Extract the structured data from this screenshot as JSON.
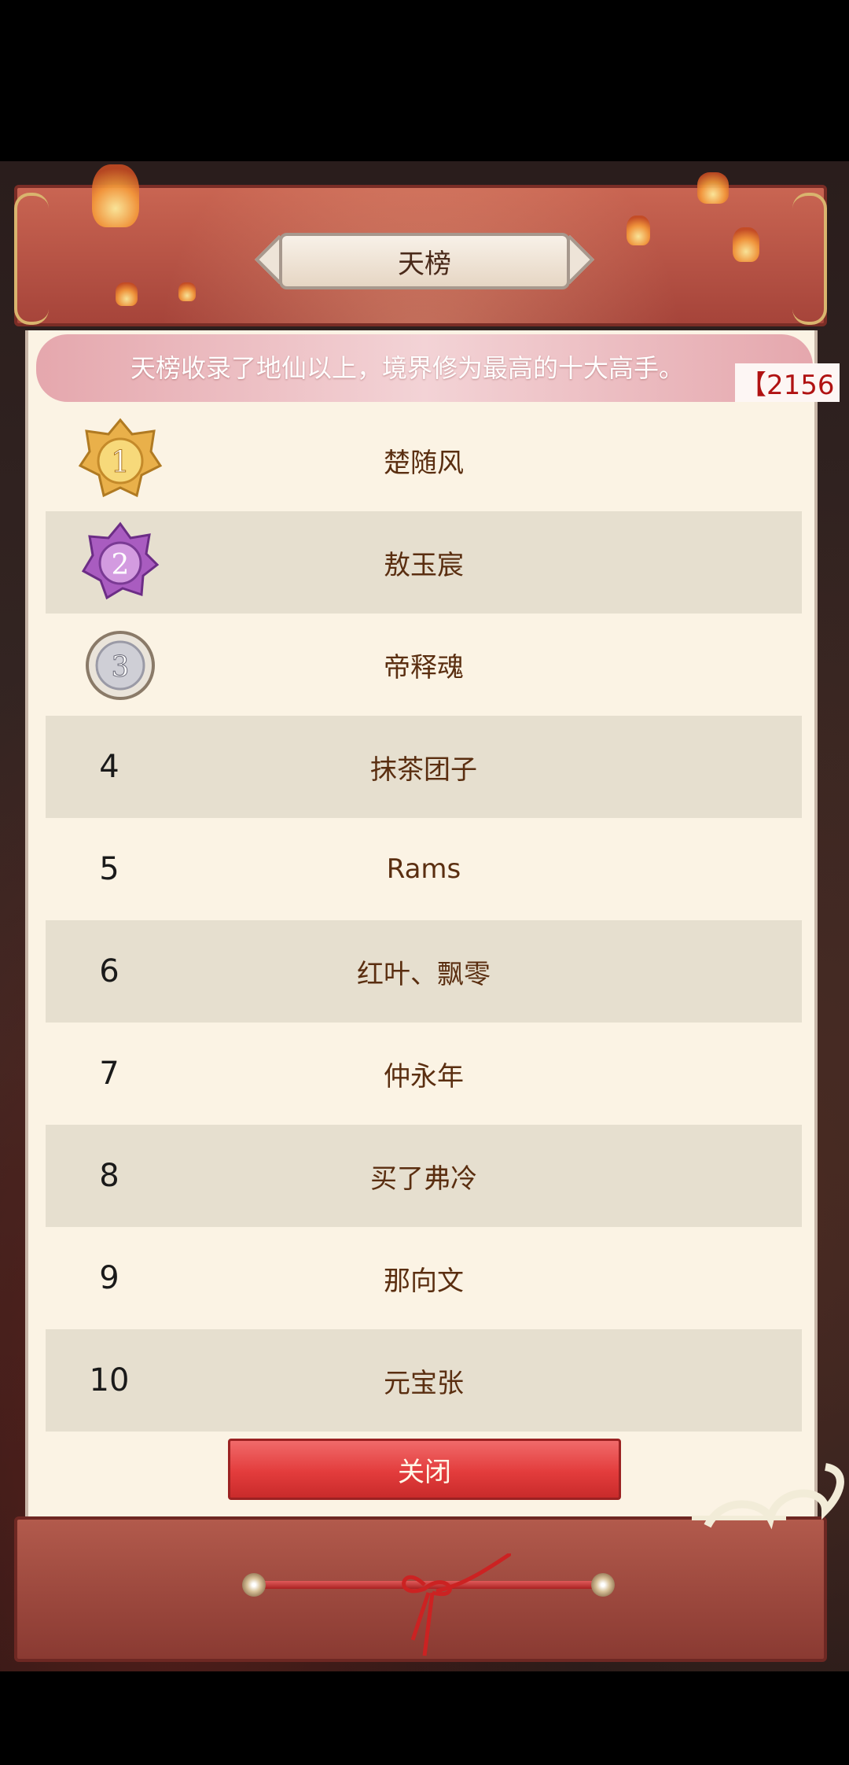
{
  "title": "天榜",
  "notice": {
    "text": "天榜收录了地仙以上，境界修为最高的十大高手。",
    "trailing": "【2156"
  },
  "rankings": [
    {
      "rank": "1",
      "name": "楚随风",
      "medal": "gold"
    },
    {
      "rank": "2",
      "name": "敖玉宸",
      "medal": "purple"
    },
    {
      "rank": "3",
      "name": "帝释魂",
      "medal": "silver"
    },
    {
      "rank": "4",
      "name": "抹茶团子"
    },
    {
      "rank": "5",
      "name": "Rams"
    },
    {
      "rank": "6",
      "name": "红叶、飘零"
    },
    {
      "rank": "7",
      "name": "仲永年"
    },
    {
      "rank": "8",
      "name": "买了弗冷"
    },
    {
      "rank": "9",
      "name": "那向文"
    },
    {
      "rank": "10",
      "name": "元宝张"
    }
  ],
  "close_label": "关闭",
  "colors": {
    "gold": "#f2c24a",
    "purple": "#b06ac4",
    "silver": "#d8d8d8",
    "button": "#e33c3c"
  }
}
